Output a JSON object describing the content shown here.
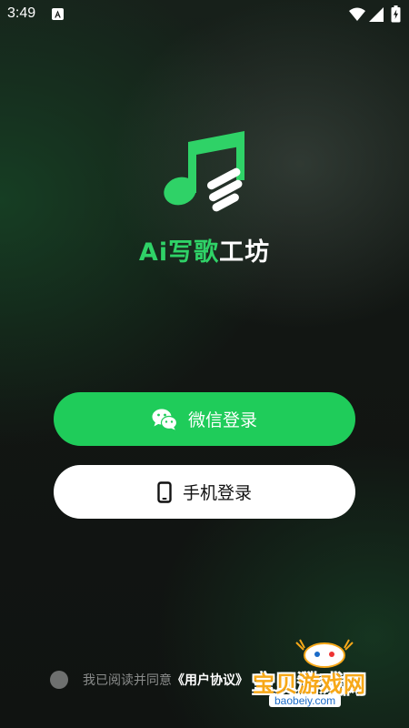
{
  "status_bar": {
    "time": "3:49",
    "notification_icon": "a-square-icon",
    "icons": [
      "wifi-icon",
      "signal-icon",
      "battery-charging-icon"
    ]
  },
  "app": {
    "title_accent": "Ai写歌",
    "title_rest": "工坊",
    "logo_icon": "music-note-icon"
  },
  "buttons": {
    "wechat_login": "微信登录",
    "phone_login": "手机登录"
  },
  "agreement": {
    "prefix": "我已阅读并同意",
    "link_user": "《用户协议》"
  },
  "watermark": {
    "text": "宝贝游戏网",
    "url": "baobeiy.com"
  },
  "colors": {
    "accent": "#1fcc5a",
    "background": "#121613",
    "button_light": "#ffffff"
  }
}
